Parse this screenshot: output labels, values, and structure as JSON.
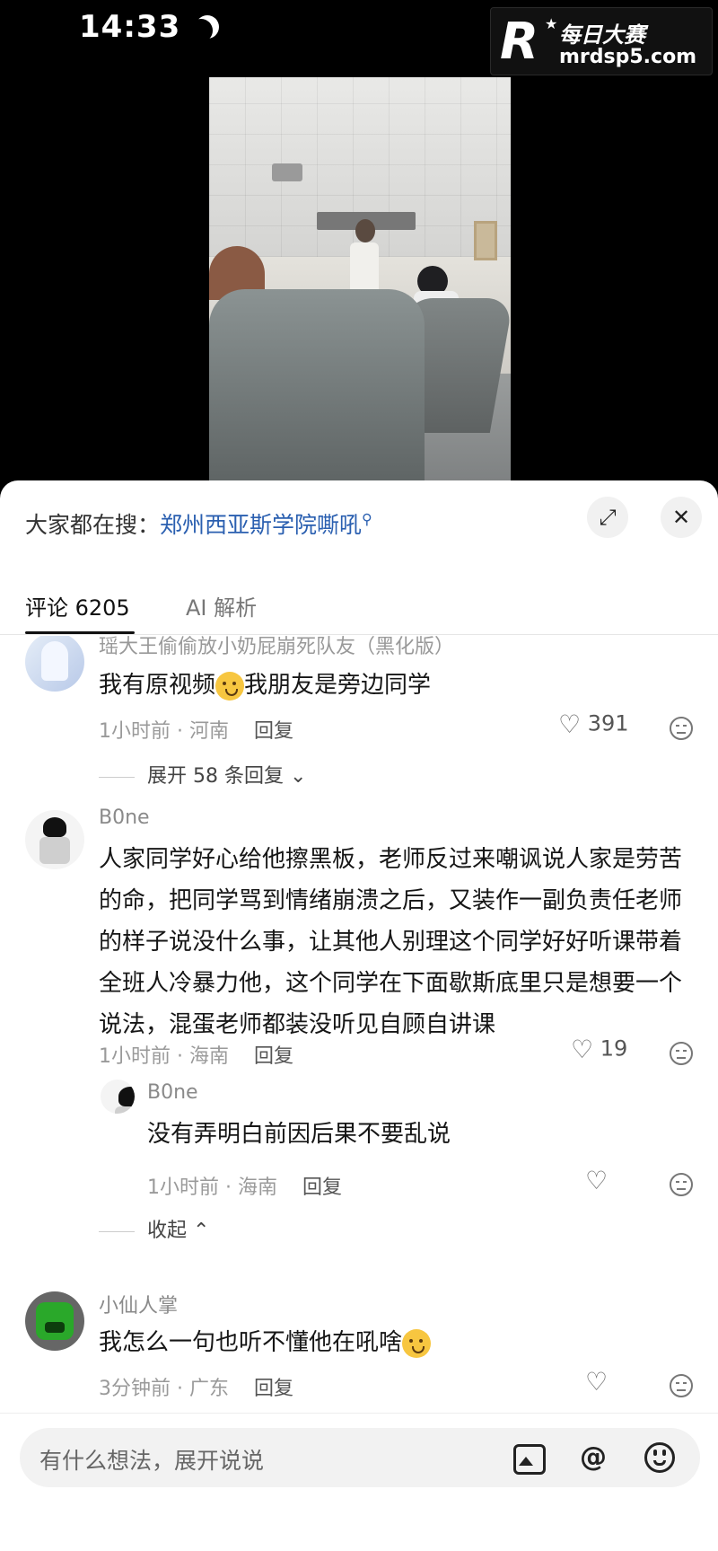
{
  "status_bar": {
    "time": "14:33"
  },
  "watermark": {
    "letter": "R",
    "title": "每日大赛",
    "url": "mrdsp5.com"
  },
  "search": {
    "prefix": "大家都在搜：",
    "query": "郑州西亚斯学院嘶吼"
  },
  "tabs": [
    {
      "label": "评论 6205",
      "active": true
    },
    {
      "label": "AI 解析",
      "active": false
    }
  ],
  "comments": [
    {
      "name": "瑶大王偷偷放小奶屁崩死队友（黑化版）",
      "text": "我有原视频",
      "text_after": "我朋友是旁边同学",
      "time_loc": "1小时前 · 河南",
      "reply_label": "回复",
      "likes": "391",
      "expand_label": "展开 58 条回复"
    },
    {
      "name": "B0ne",
      "text": "人家同学好心给他擦黑板，老师反过来嘲讽说人家是劳苦的命，把同学骂到情绪崩溃之后，又装作一副负责任老师的样子说没什么事，让其他人别理这个同学好好听课带着全班人冷暴力他，这个同学在下面歇斯底里只是想要一个说法，混蛋老师都装没听见自顾自讲课",
      "time_loc": "1小时前 · 海南",
      "reply_label": "回复",
      "likes": "19",
      "replies": [
        {
          "name": "B0ne",
          "text": "没有弄明白前因后果不要乱说",
          "time_loc": "1小时前 · 海南",
          "reply_label": "回复"
        }
      ],
      "collapse_label": "收起"
    },
    {
      "name": "小仙人掌",
      "text": "我怎么一句也听不懂他在吼啥",
      "time_loc": "3分钟前 · 广东",
      "reply_label": "回复"
    }
  ],
  "input": {
    "placeholder": "有什么想法，展开说说"
  },
  "icons": {
    "moon": "moon-icon",
    "search": "search-icon",
    "expand": "expand-icon",
    "close": "close-icon",
    "heart": "heart-icon",
    "dislike": "dislike-icon",
    "chevron_down": "chevron-down-icon",
    "chevron_up": "chevron-up-icon",
    "image": "image-icon",
    "at": "at-icon",
    "emoji": "emoji-icon"
  },
  "colors": {
    "link": "#2a5fb0",
    "accent_underline": "#111111"
  }
}
